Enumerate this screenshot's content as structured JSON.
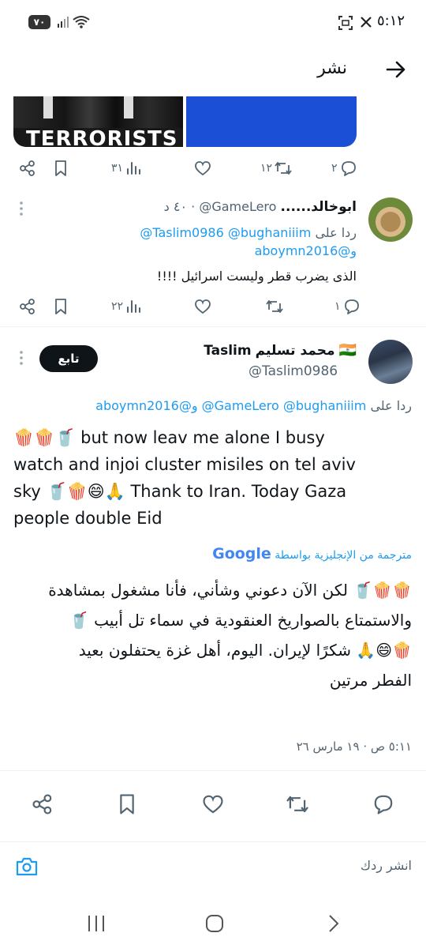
{
  "status_bar": {
    "time": "٥:١٢",
    "battery": "٧٠"
  },
  "header": {
    "title": "نشر"
  },
  "media": {
    "banner_text": "TERRORISTS"
  },
  "tweet1": {
    "actions": {
      "reply_count": "٢",
      "retweet_count": "١٢",
      "views_count": "٣١"
    }
  },
  "reply1": {
    "name": "ابوخالد......",
    "handle": "@GameLero",
    "time": "٤٠ د",
    "replying_to_label": "ردا على",
    "mention1": "@bughaniiim",
    "mention2": "@Taslim0986",
    "mention3": "و@aboymn2016",
    "text": "الذى يضرب قطر وليست اسرائيل !!!!",
    "actions": {
      "reply_count": "١",
      "views_count": "٢٢"
    }
  },
  "main_tweet": {
    "flag": "🇮🇳",
    "name_ar": "محمد تسليم",
    "name_en": "Taslim",
    "handle": "@Taslim0986",
    "follow_label": "تابع",
    "replying_to_label": "ردا على",
    "mention1": "@bughaniiim",
    "mention2": "@GameLero",
    "mention3": "و@aboymn2016",
    "text_line1": "🍿🍿🥤 but now leav me alone I busy",
    "text_line2": "watch and injoi cluster misiles on tel aviv",
    "text_line3": "sky 🥤🍿😄🙏 Thank to Iran. Today Gaza",
    "text_line4": "people double Eid",
    "translated_label": "مترجمة من الإنجليزية بواسطة",
    "translator": "Google",
    "translation_line1": "🍿🍿🥤 لكن الآن دعوني وشأني، فأنا مشغول بمشاهدة",
    "translation_line2": "والاستمتاع بالصواريخ العنقودية في سماء تل أبيب 🥤",
    "translation_line3": "🍿😄🙏 شكرًا لإيران. اليوم، أهل غزة يحتفلون بعيد",
    "translation_line4": "الفطر مرتين",
    "timestamp": "٥:١١ ص · ١٩ مارس ٢٦"
  },
  "reply_bar": {
    "placeholder": "انشر ردك"
  },
  "colors": {
    "accent": "#1d9bf0",
    "text": "#0f1419",
    "secondary": "#536471"
  }
}
